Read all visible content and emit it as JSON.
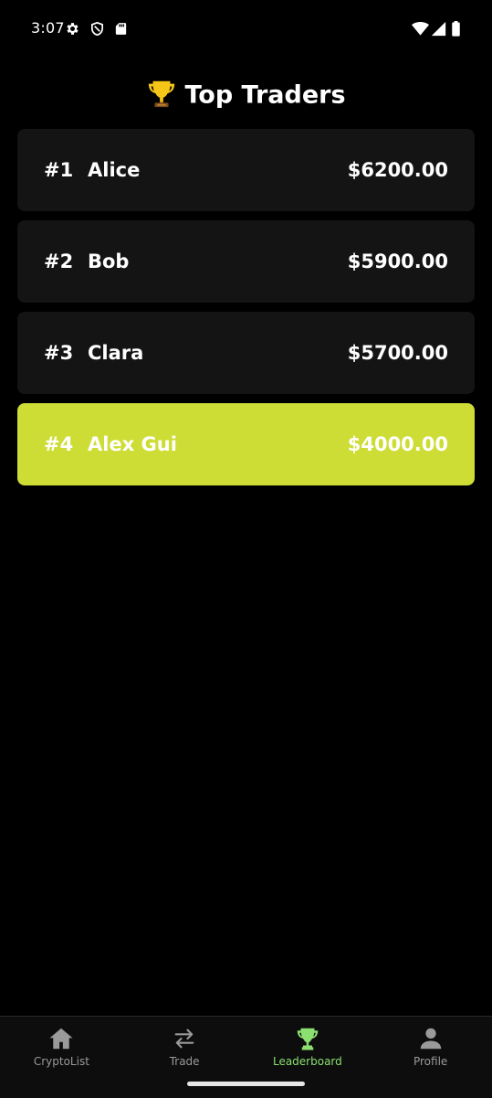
{
  "status_bar": {
    "time": "3:07",
    "icons": [
      "settings-icon",
      "shield-icon",
      "sd-card-icon",
      "wifi-icon",
      "signal-icon",
      "battery-icon"
    ]
  },
  "header": {
    "title": "Top Traders",
    "icon": "trophy-icon"
  },
  "leaderboard": [
    {
      "rank": "#1",
      "name": "Alice",
      "amount": "$6200.00",
      "current_user": false
    },
    {
      "rank": "#2",
      "name": "Bob",
      "amount": "$5900.00",
      "current_user": false
    },
    {
      "rank": "#3",
      "name": "Clara",
      "amount": "$5700.00",
      "current_user": false
    },
    {
      "rank": "#4",
      "name": "Alex Gui",
      "amount": "$4000.00",
      "current_user": true
    }
  ],
  "bottom_nav": {
    "items": [
      {
        "label": "CryptoList",
        "icon": "home-icon",
        "active": false
      },
      {
        "label": "Trade",
        "icon": "swap-arrows-icon",
        "active": false
      },
      {
        "label": "Leaderboard",
        "icon": "trophy-icon",
        "active": true
      },
      {
        "label": "Profile",
        "icon": "person-icon",
        "active": false
      }
    ]
  },
  "colors": {
    "background": "#000000",
    "row_background": "#141414",
    "highlight": "#cddd35",
    "nav_active": "#8be070",
    "nav_inactive": "#9a9a9a"
  }
}
